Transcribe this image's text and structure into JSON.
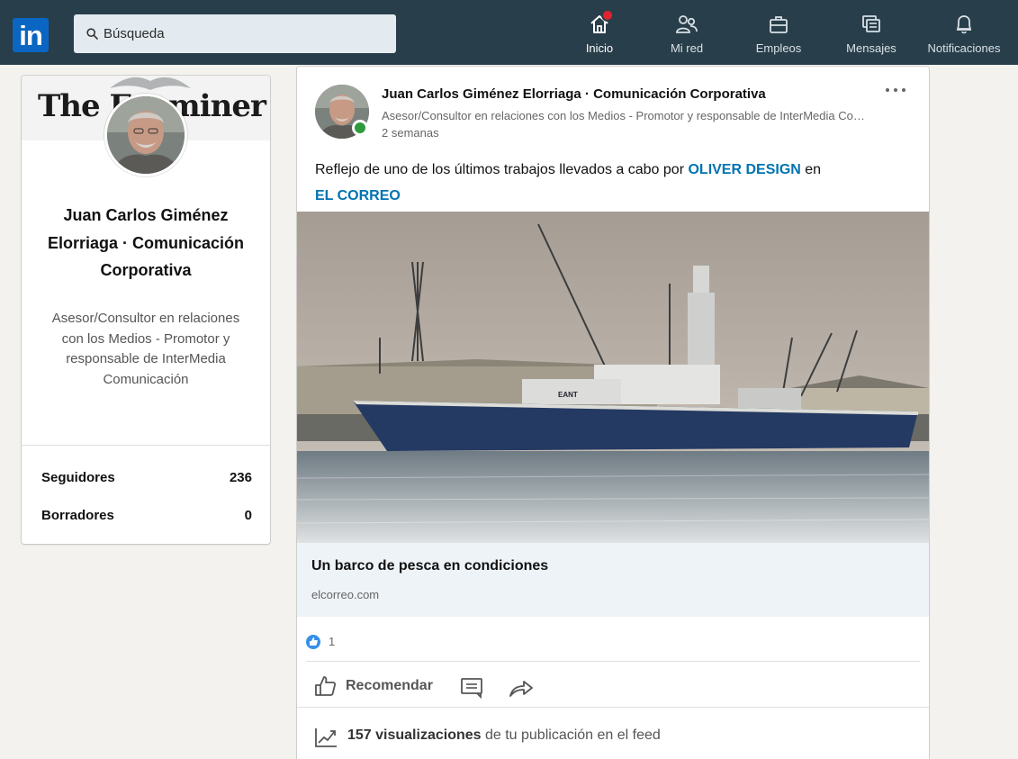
{
  "nav": {
    "logo": "in",
    "search_placeholder": "Búsqueda",
    "items": [
      {
        "label": "Inicio",
        "icon": "home-icon",
        "active": true,
        "has_badge": true
      },
      {
        "label": "Mi red",
        "icon": "network-icon"
      },
      {
        "label": "Empleos",
        "icon": "briefcase-icon"
      },
      {
        "label": "Mensajes",
        "icon": "messages-icon"
      },
      {
        "label": "Notificaciones",
        "icon": "bell-icon"
      }
    ]
  },
  "profile": {
    "banner_text": "The Examiner",
    "name": "Juan Carlos Giménez Elorriaga · Comunicación Corporativa",
    "headline": "Asesor/Consultor en relaciones con los Medios - Promotor y responsable de InterMedia Comunicación",
    "stats": [
      {
        "label": "Seguidores",
        "value": "236"
      },
      {
        "label": "Borradores",
        "value": "0"
      }
    ]
  },
  "post": {
    "author": "Juan Carlos Giménez Elorriaga · Comunicación Corporativa",
    "author_headline": "Asesor/Consultor en relaciones con los Medios - Promotor y responsable de InterMedia Comunicación",
    "time": "2 semanas",
    "text_before": "Reflejo de uno de los últimos trabajos llevados a cabo por ",
    "mention_1": "OLIVER DESIGN",
    "text_middle": " en ",
    "mention_2": "EL CORREO",
    "ship_hull_text": "EANT",
    "link_title": "Un barco de pesca en condiciones",
    "link_domain": "elcorreo.com",
    "reaction_count": "1",
    "actions": {
      "like": "Recomendar",
      "comment_icon": "comment-icon",
      "share_icon": "share-icon"
    },
    "views_count": "157 visualizaciones",
    "views_suffix": " de tu publicación en el feed"
  },
  "colors": {
    "topbar": "#283e4a",
    "accent": "#0073b1",
    "badge": "#e0242f",
    "online": "#2d9b3c"
  }
}
